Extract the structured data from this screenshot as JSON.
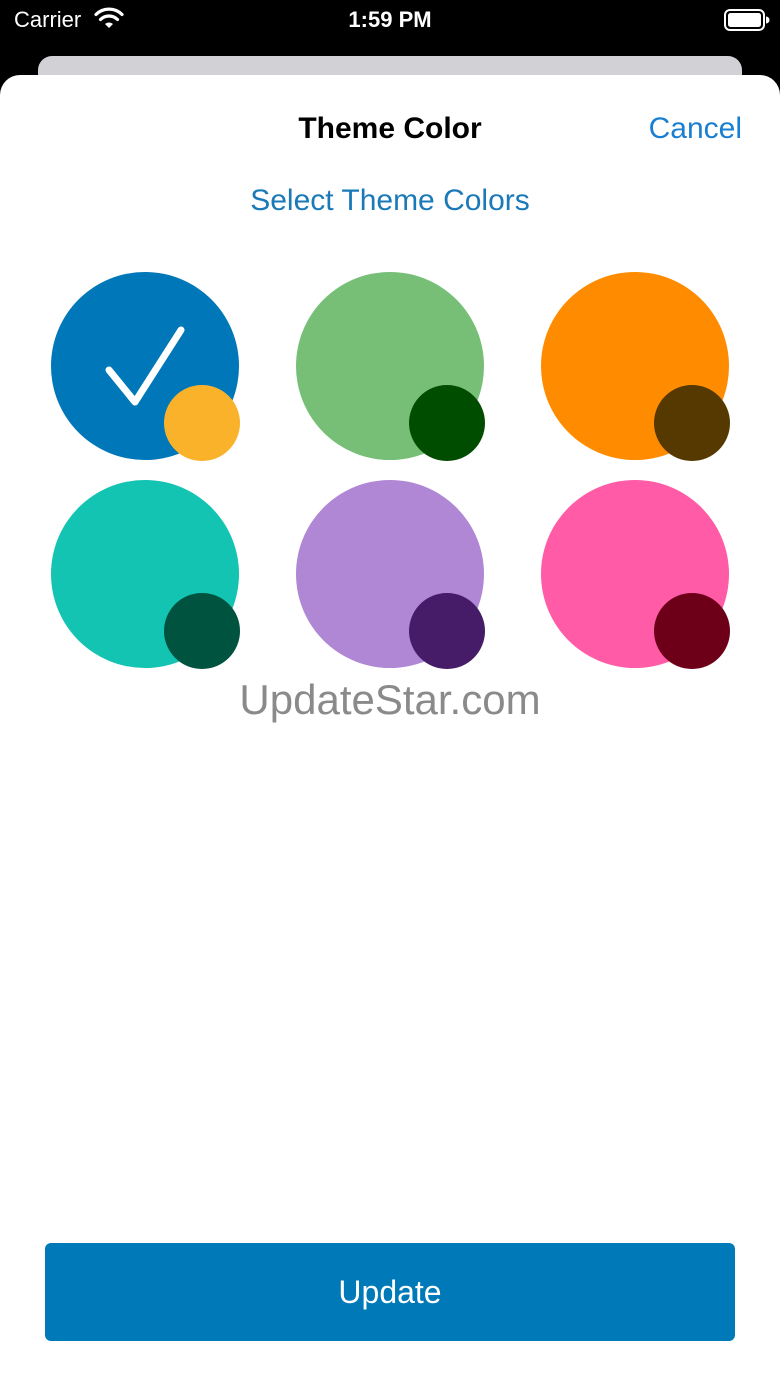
{
  "status_bar": {
    "carrier": "Carrier",
    "time": "1:59 PM",
    "wifi_icon": "wifi-icon",
    "battery_icon": "battery-full-icon"
  },
  "header": {
    "title": "Theme Color",
    "cancel_label": "Cancel"
  },
  "main": {
    "section_title": "Select Theme Colors",
    "swatches": [
      {
        "name": "blue-orange",
        "main_color": "#0077b8",
        "accent_color": "#fbb22b",
        "selected": true
      },
      {
        "name": "green",
        "main_color": "#77bf77",
        "accent_color": "#004d00",
        "selected": false
      },
      {
        "name": "orange-brown",
        "main_color": "#ff8c00",
        "accent_color": "#553900",
        "selected": false
      },
      {
        "name": "teal",
        "main_color": "#13c4b2",
        "accent_color": "#00533f",
        "selected": false
      },
      {
        "name": "purple",
        "main_color": "#b087d4",
        "accent_color": "#461b68",
        "selected": false
      },
      {
        "name": "pink",
        "main_color": "#ff5ba7",
        "accent_color": "#6d0018",
        "selected": false
      }
    ],
    "selected_icon": "checkmark-icon"
  },
  "watermark": "UpdateStar.com",
  "footer": {
    "update_label": "Update"
  },
  "colors": {
    "accent": "#1a7fd0",
    "button": "#0079b8"
  }
}
